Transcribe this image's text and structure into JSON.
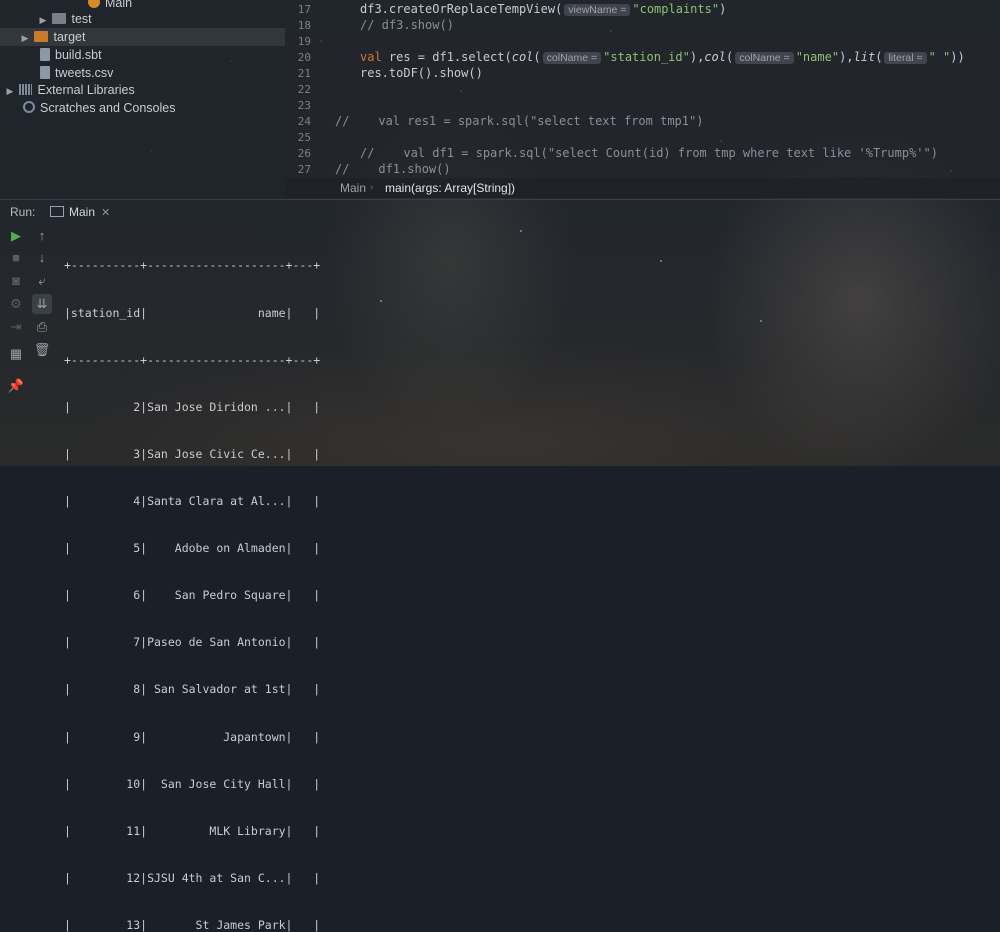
{
  "project_tree": {
    "items": [
      {
        "label": "Main",
        "icon": "scala-object-icon"
      },
      {
        "label": "test",
        "icon": "folder-icon"
      },
      {
        "label": "target",
        "icon": "folder-orange-icon"
      },
      {
        "label": "build.sbt",
        "icon": "sbt-file-icon"
      },
      {
        "label": "tweets.csv",
        "icon": "csv-file-icon"
      },
      {
        "label": "External Libraries",
        "icon": "library-icon"
      },
      {
        "label": "Scratches and Consoles",
        "icon": "scratches-icon"
      }
    ]
  },
  "editor": {
    "line_numbers": [
      "17",
      "18",
      "19",
      "20",
      "21",
      "22",
      "23",
      "24",
      "25",
      "26",
      "27"
    ],
    "line17": {
      "code": "df3.createOrReplaceTempView(",
      "hint": "viewName =",
      "string": "\"complaints\"",
      "end": ")"
    },
    "line18": "// df3.show()",
    "line20": {
      "kw": "val",
      "p1": " res = df1.select(",
      "col": "col",
      "paren": "(",
      "hint1": "colName =",
      "s1": "\"station_id\"",
      "mid": "),",
      "hint2": "colName =",
      "s2": "\"name\"",
      "mid2": "),",
      "lit": "lit",
      "hint3": "literal =",
      "s3": "\" \"",
      "end": "))"
    },
    "line21": "res.toDF().show()",
    "line24": "//    val res1 = spark.sql(\"select text from tmp1\")",
    "line26": "//    val df1 = spark.sql(\"select Count(id) from tmp where text like '%Trump%'\")",
    "line27": "//    df1.show()",
    "breadcrumb": {
      "item1": "Main",
      "item2": "main(args: Array[String])"
    }
  },
  "run_panel": {
    "label": "Run:",
    "tab": "Main",
    "toolbar_icons": [
      "run-icon",
      "up-arrow-icon",
      "stop-icon",
      "down-arrow-icon",
      "camera-icon",
      "soft-wrap-icon",
      "settings-icon",
      "scroll-to-end-icon",
      "exit-icon",
      "print-icon",
      "layout-icon",
      "trash-icon",
      "pin-icon"
    ],
    "console_lines": [
      "+----------+--------------------+---+",
      "|station_id|                name|   |",
      "+----------+--------------------+---+",
      "|         2|San Jose Diridon ...|   |",
      "|         3|San Jose Civic Ce...|   |",
      "|         4|Santa Clara at Al...|   |",
      "|         5|    Adobe on Almaden|   |",
      "|         6|    San Pedro Square|   |",
      "|         7|Paseo de San Antonio|   |",
      "|         8| San Salvador at 1st|   |",
      "|         9|           Japantown|   |",
      "|        10|  San Jose City Hall|   |",
      "|        11|         MLK Library|   |",
      "|        12|SJSU 4th at San C...|   |",
      "|        13|       St James Park|   |"
    ]
  }
}
